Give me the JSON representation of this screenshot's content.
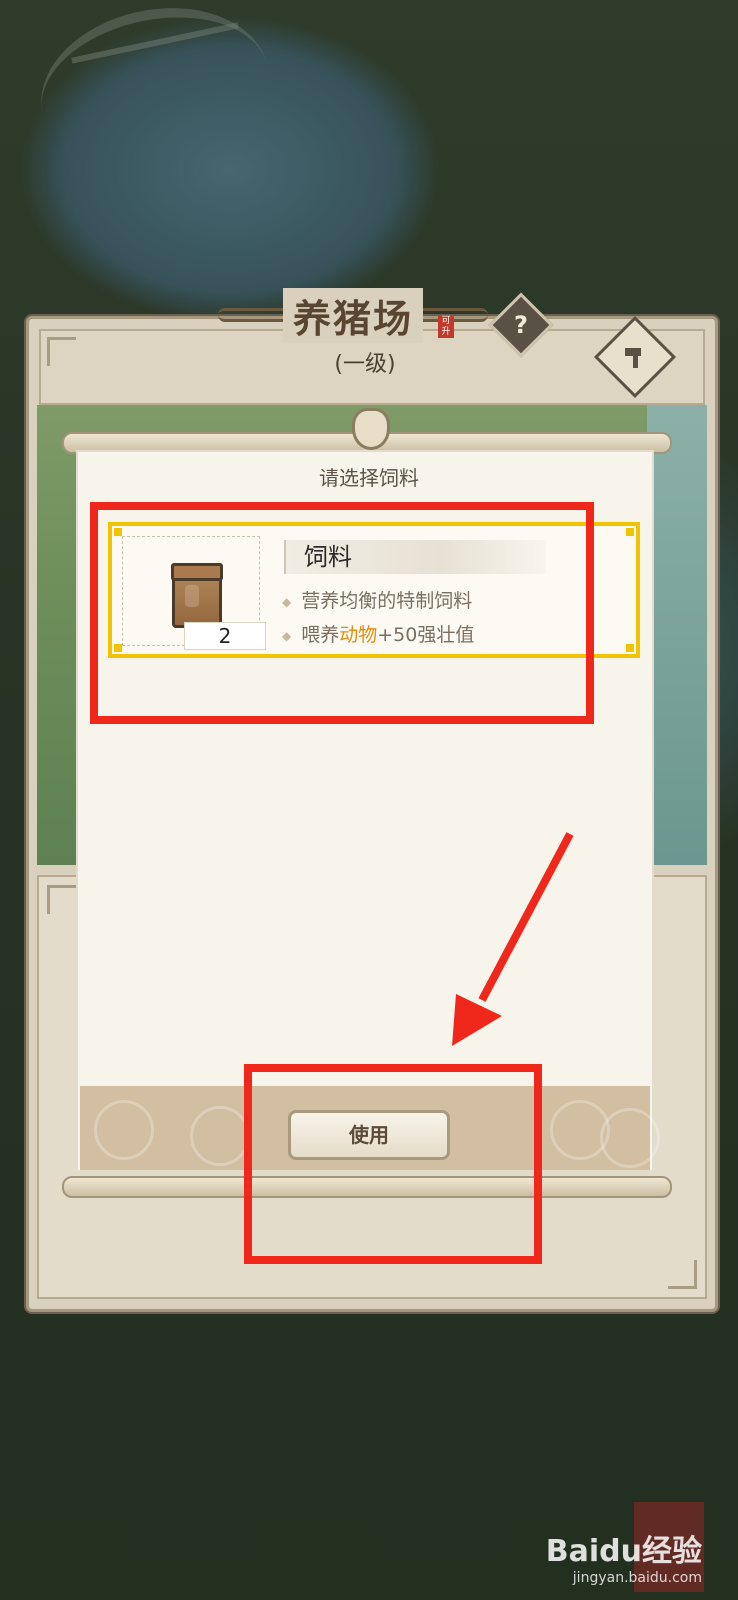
{
  "building": {
    "title": "养猪场",
    "seal": "可升",
    "level": "(一级)"
  },
  "icons": {
    "help": "?",
    "build": "hammer-icon"
  },
  "dialog": {
    "prompt": "请选择饲料",
    "use_label": "使用"
  },
  "item": {
    "name": "饲料",
    "count": "2",
    "icon": "feed-bag-icon",
    "desc1": "营养均衡的特制饲料",
    "desc2_prefix": "喂养",
    "desc2_highlight": "动物",
    "desc2_suffix": "+50强壮值"
  },
  "watermark": {
    "brand": "Baidu经验",
    "url": "jingyan.baidu.com"
  },
  "colors": {
    "highlight": "#e08e10",
    "selected_border": "#f2c300",
    "annotation": "#f0281c"
  }
}
